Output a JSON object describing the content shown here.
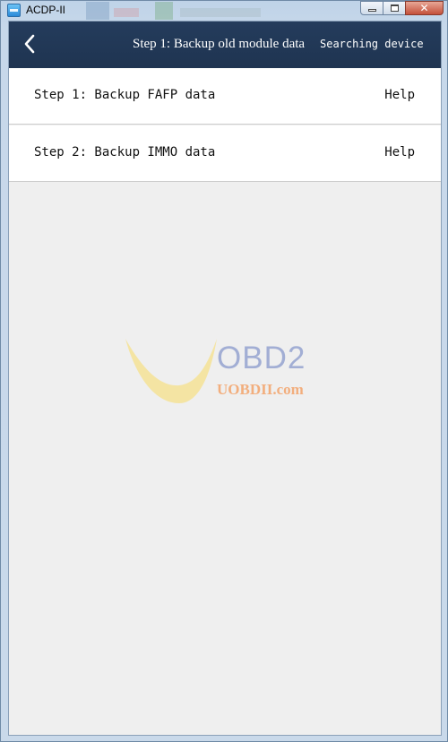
{
  "window": {
    "title": "ACDP-II"
  },
  "header": {
    "title": "Step 1: Backup old module data",
    "status": "Searching device"
  },
  "steps": [
    {
      "label": "Step 1: Backup FAFP data",
      "help": "Help"
    },
    {
      "label": "Step 2: Backup IMMO data",
      "help": "Help"
    }
  ],
  "watermark": {
    "brand": "OBD2",
    "site": "UOBDII.com"
  },
  "colors": {
    "header_bg": "#213752",
    "page_bg": "#efefef",
    "row_bg": "#ffffff",
    "watermark_blue": "#9aa8d2",
    "watermark_orange": "#f3a36a",
    "watermark_yellow": "#f5e08a"
  }
}
